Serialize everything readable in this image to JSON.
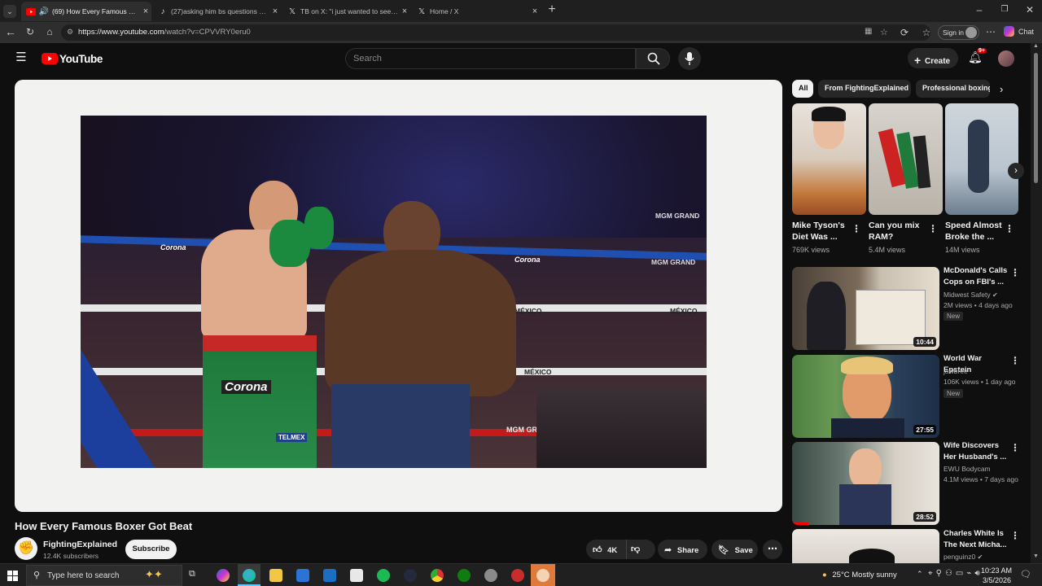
{
  "browser": {
    "tabs": [
      {
        "title": "(69) How Every Famous Boxer Got Beat",
        "active": true
      },
      {
        "title": "(27)asking him bs questions #ufc"
      },
      {
        "title": "TB on X: \"i just wanted to see the"
      },
      {
        "title": "Home / X"
      }
    ],
    "new_tab": "+",
    "url_domain": "https://www.youtube.com",
    "url_path": "/watch?v=CPVVRY0eru0",
    "signin_label": "Sign in",
    "chat_label": "Chat"
  },
  "youtube": {
    "logo_text": "YouTube",
    "search_placeholder": "Search",
    "create_label": "Create",
    "notification_badge": "9+",
    "video": {
      "title": "How Every Famous Boxer Got Beat",
      "channel": "FightingExplained",
      "subscribers": "12.4K subscribers",
      "subscribe_label": "Subscribe",
      "likes": "4K",
      "share_label": "Share",
      "save_label": "Save"
    },
    "chips": [
      "All",
      "From FightingExplained",
      "Professional boxing"
    ],
    "shorts": [
      {
        "title": "Mike Tyson's Diet Was ...",
        "views": "769K views"
      },
      {
        "title": "Can you mix RAM?",
        "views": "5.4M views"
      },
      {
        "title": "Speed Almost Broke the ...",
        "views": "14M views"
      }
    ],
    "recommended": [
      {
        "title": "McDonald's Calls Cops on FBI's ...",
        "channel": "Midwest Safety",
        "meta": "2M views • 4 days ago",
        "badge": "New",
        "duration": "10:44"
      },
      {
        "title": "World War Epstein",
        "channel": "jawbree",
        "meta": "106K views • 1 day ago",
        "badge": "New",
        "duration": "27:55"
      },
      {
        "title": "Wife Discovers Her Husband's ...",
        "channel": "EWU Bodycam",
        "meta": "4.1M views • 7 days ago",
        "duration": "28:52"
      },
      {
        "title": "Charles White Is The Next Micha...",
        "channel": "penguinz0",
        "meta": ""
      }
    ],
    "video_frame_text": {
      "sponsor": "Corona",
      "arena": "MGM GRAND",
      "country": "MÉXICO",
      "trunks": "TELMEX"
    }
  },
  "taskbar": {
    "search_placeholder": "Type here to search",
    "weather": "25°C  Mostly sunny",
    "time": "10:23 AM",
    "date": "3/5/2026"
  },
  "colors": {
    "yt_red": "#ff0000",
    "accent_blue": "#3ea6ff",
    "dark_bg": "#0f0f0f"
  }
}
